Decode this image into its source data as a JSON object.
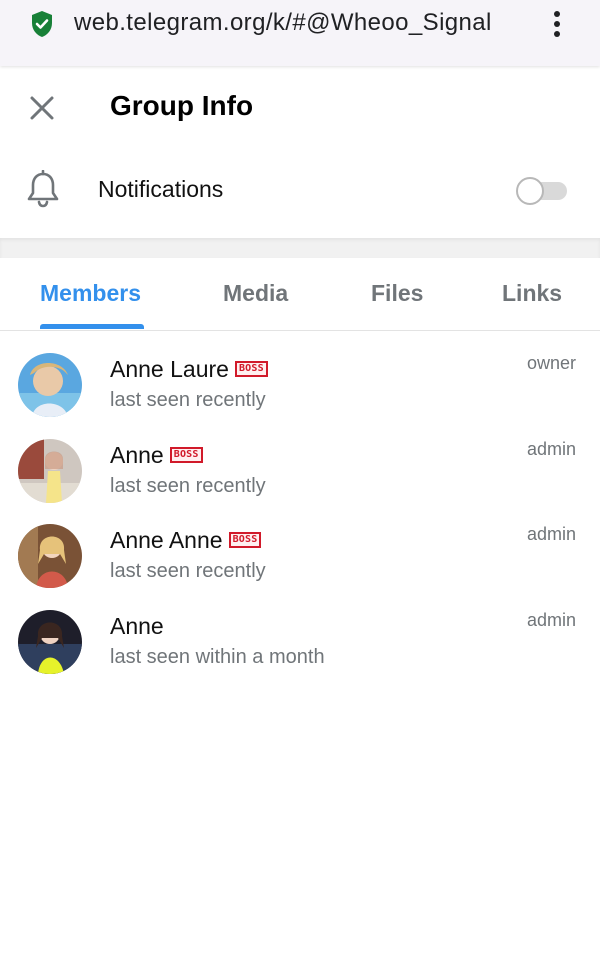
{
  "browser": {
    "url": "web.telegram.org/k/#@Wheoo_Signal",
    "icons": [
      "shield-check-icon",
      "kebab-menu-icon"
    ]
  },
  "header": {
    "title": "Group Info",
    "close_icon": "close-icon"
  },
  "notifications": {
    "label": "Notifications",
    "icon": "bell-icon",
    "enabled": false
  },
  "tabs": [
    {
      "label": "Members",
      "active": true
    },
    {
      "label": "Media",
      "active": false
    },
    {
      "label": "Files",
      "active": false
    },
    {
      "label": "Links",
      "active": false
    }
  ],
  "members": [
    {
      "name": "Anne Laure",
      "badge": "BOSS",
      "status": "last seen recently",
      "role": "owner"
    },
    {
      "name": "Anne",
      "badge": "BOSS",
      "status": "last seen recently",
      "role": "admin"
    },
    {
      "name": "Anne Anne",
      "badge": "BOSS",
      "status": "last seen recently",
      "role": "admin"
    },
    {
      "name": "Anne",
      "badge": "",
      "status": "last seen within a month",
      "role": "admin"
    }
  ],
  "colors": {
    "accent": "#3390ec",
    "secondary_text": "#707579",
    "badge_red": "#d11a2a",
    "security_green": "#188038"
  }
}
